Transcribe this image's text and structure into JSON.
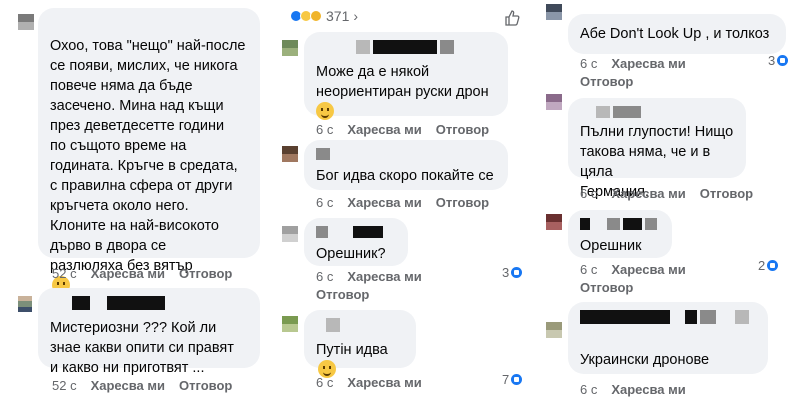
{
  "left": {
    "comment1": {
      "text": "Охоо, това \"нещо\" най-после\nсе появи, мислих, че никога\nповече няма да бъде\nзасечено. Мина над къщи\nпрез деветдесетте години\nпо същото време на\nгодината. Кръгче в средата,\nс правилна сфера от други\nкръгчета около него.\nКлоните на най-високото\nдърво в двора се\nразлюляха без вятър",
      "time": "52 с",
      "like": "Харесва ми",
      "reply": "Отговор"
    },
    "comment2": {
      "text": "Мистериозни ??? Кой ли\nзнае какви опити си правят\nи какво ни приготвят ...",
      "time": "52 с",
      "like": "Харесва ми",
      "reply": "Отговор"
    }
  },
  "middle": {
    "header_count": "371",
    "header_chevron": "›",
    "comment1": {
      "text": "Може да е някой\nнеориентиран руски дрон",
      "time": "6 с",
      "like": "Харесва ми",
      "reply": "Отговор"
    },
    "comment2": {
      "text": "Бог идва скоро покайте се",
      "time": "6 с",
      "like": "Харесва ми",
      "reply": "Отговор"
    },
    "comment3": {
      "text": "Орешник?",
      "time": "6 с",
      "like": "Харесва ми",
      "reply": "Отговор",
      "reactions": "3"
    },
    "comment4": {
      "text": "Путін идва",
      "time": "6 с",
      "like": "Харесва ми",
      "reactions": "7"
    }
  },
  "right": {
    "comment1": {
      "text": "Абе Don't Look Up , и толкоз",
      "time": "6 с",
      "like": "Харесва ми",
      "reply": "Отговор",
      "reactions": "3"
    },
    "comment2": {
      "text": "Пълни глупости! Нищо\nтакова няма, че и  в цяла\nГермания.",
      "time": "6 с",
      "like": "Харесва ми",
      "reply": "Отговор"
    },
    "comment3": {
      "text": "Орешник",
      "time": "6 с",
      "like": "Харесва ми",
      "reply": "Отговор",
      "reactions": "2"
    },
    "comment4": {
      "text": "Украински дронове",
      "time": "6 с",
      "like": "Харесва ми"
    }
  },
  "icons": {
    "reaction_like": "like-icon",
    "emoji": "smiling-face-emoji",
    "thumb": "thumbs-up-outline-icon"
  },
  "colors": {
    "bubble": "#f0f2f5",
    "meta": "#65676b",
    "reaction_blue": "#1877f2",
    "emoji_yellow": "#f7c844"
  }
}
